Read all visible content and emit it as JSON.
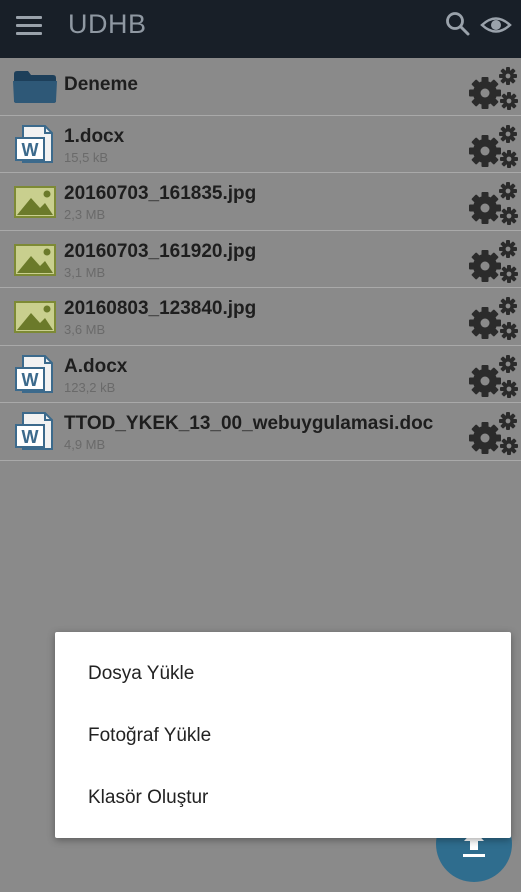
{
  "app": {
    "title": "UDHB"
  },
  "icons": {
    "menu": "menu-icon",
    "search": "search-icon",
    "visibility": "eye-icon",
    "options": "gear-icon",
    "upload": "upload-icon"
  },
  "files": [
    {
      "name": "Deneme",
      "size": "",
      "type": "folder"
    },
    {
      "name": "1.docx",
      "size": "15,5 kB",
      "type": "word"
    },
    {
      "name": "20160703_161835.jpg",
      "size": "2,3 MB",
      "type": "image"
    },
    {
      "name": "20160703_161920.jpg",
      "size": "3,1 MB",
      "type": "image"
    },
    {
      "name": "20160803_123840.jpg",
      "size": "3,6 MB",
      "type": "image"
    },
    {
      "name": "A.docx",
      "size": "123,2 kB",
      "type": "word"
    },
    {
      "name": "TTOD_YKEK_13_00_webuygulamasi.doc",
      "size": "4,9 MB",
      "type": "word"
    }
  ],
  "popup_menu": {
    "items": [
      {
        "label": "Dosya Yükle"
      },
      {
        "label": "Fotoğraf Yükle"
      },
      {
        "label": "Klasör Oluştur"
      }
    ]
  },
  "colors": {
    "appbar": "#181f28",
    "overlay_background": "#8a8a8a",
    "fab": "#2f6d8e",
    "folder": "#2e5877",
    "word": "#3c6a8c",
    "image": "#7d8a35"
  }
}
